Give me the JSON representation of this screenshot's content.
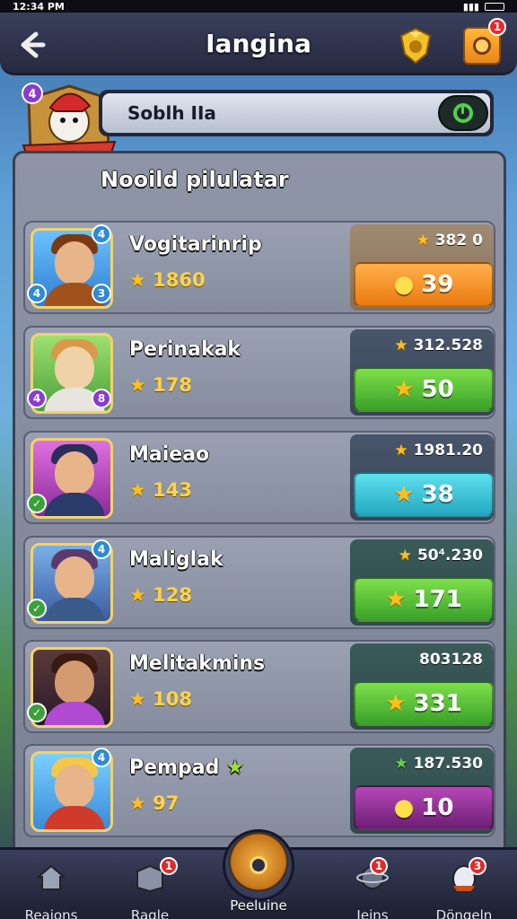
{
  "status_bar": {
    "time": "12:34 PM"
  },
  "header": {
    "title": "Iangina"
  },
  "search": {
    "value": "Soblh IIa"
  },
  "panel": {
    "title": "Nooild pilulatar"
  },
  "players": [
    {
      "name": "Vogitarinrip",
      "score": "1860",
      "right_value": "382 0",
      "button_value": "39",
      "button_icon": "coin-icon",
      "color": "orange",
      "badges": [
        "4",
        "3",
        "4"
      ]
    },
    {
      "name": "Perinakak",
      "score": "178",
      "right_value": "312.528",
      "button_value": "50",
      "button_icon": "star-icon",
      "color": "green",
      "badges": [
        "4",
        "8"
      ]
    },
    {
      "name": "Maieao",
      "score": "143",
      "right_value": "1981.20",
      "button_value": "38",
      "button_icon": "star-icon",
      "color": "teal",
      "badges": []
    },
    {
      "name": "Maliglak",
      "score": "128",
      "right_value": "50⁴.230",
      "button_value": "171",
      "button_icon": "star-icon",
      "color": "green",
      "badges": [
        "4"
      ]
    },
    {
      "name": "Melitakmins",
      "score": "108",
      "right_value": "803128",
      "button_value": "331",
      "button_icon": "star-icon",
      "color": "green",
      "badges": []
    },
    {
      "name": "Pempad",
      "score": "97",
      "right_value": "187.530",
      "button_value": "10",
      "button_icon": "coin-icon",
      "color": "purple",
      "badges": [
        "4"
      ]
    }
  ],
  "nav": {
    "items": [
      {
        "label": "Reaions",
        "icon": "home-icon"
      },
      {
        "label": "Ragle",
        "icon": "box-icon",
        "badge": "1"
      },
      {
        "label": "Peeluine",
        "icon": "target-icon"
      },
      {
        "label": "Ieins",
        "icon": "planet-icon",
        "badge": "1"
      },
      {
        "label": "Döngeln",
        "icon": "egg-icon",
        "badge": "3"
      }
    ]
  },
  "notifications": {
    "header_badge": "1"
  },
  "colors": {
    "accent": "#ffc01e",
    "header_bg": "#2a2e48",
    "panel_bg": "#8e95a6"
  }
}
